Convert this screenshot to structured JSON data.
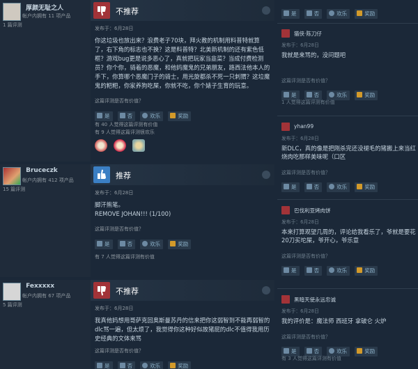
{
  "reviews": [
    {
      "username": "厚颜无耻之人",
      "games_owned": "帐户内拥有 11 项产品",
      "review_count": "1 篇评测",
      "verdict": "不推荐",
      "posted": "发布于：6月28日",
      "text": "你这垃圾也放出来？浪费老子70块，拜火教的机制用料普特就算了，右下角的标志也不换？这是料普特？北美新机制的还有紫色低框？游戏bug更是说多恶心了，真就把玩家当韭菜？当成付费检测员？你个你，骑着的恶魔，和他妈魔鬼的兄弟朋友，路西法他本人的手下，你算哪个恶魔门子的骑士，用光旋都杀不死一只刺猬？这垃魔鬼的粑粑，你家养狗吃屎，你就不吃，你个婊子生育的玩意。",
      "helpful_q": "这篇评测是否有价值？",
      "btn_yes": "是",
      "btn_no": "否",
      "btn_funny": "欢乐",
      "btn_award": "奖励",
      "stat1": "有 40 人觉得这篇评测有价值",
      "stat2": "有 9 人觉得这篇评测很欢乐"
    },
    {
      "username": "Bruceczk",
      "games_owned": "帐户内拥有 412 项产品",
      "review_count": "15 篇评测",
      "verdict": "推荐",
      "posted": "发布于：6月28日",
      "text1": "脚汗熊笔。",
      "text2": "REMOVE JOHAN!!! (1/100)",
      "helpful_q": "这篇评测是否有价值？",
      "btn_yes": "是",
      "btn_no": "否",
      "btn_funny": "欢乐",
      "btn_award": "奖励",
      "stat1": "有 7 人觉得这篇评测有价值"
    },
    {
      "username": "Fexxxxx",
      "games_owned": "帐户内拥有 67 项产品",
      "review_count": "5 篇评测",
      "verdict": "不推荐",
      "posted": "发布于：6月28日",
      "text": "我真他妈想用哥萨克回奥斯曼苏丹的信来把你这弱智到不能再弱智的dlc骂一遍，但太烦了，我觉得你这种好似故猪屁的dlc不值得我用历史经典的文体来骂",
      "helpful_q": "这篇评测是否有价值？",
      "btn_yes": "是",
      "btn_no": "否",
      "btn_funny": "欢乐",
      "btn_award": "奖励"
    }
  ],
  "right_top": {
    "btn_yes": "是",
    "btn_no": "否",
    "btn_funny": "欢乐",
    "btn_award": "奖励"
  },
  "comments": [
    {
      "username": "猫侠·陈刀仔",
      "posted": "发布于：6月28日",
      "text": "我就是来骂的，没问题吧",
      "helpful_q": "这篇评测是否有价值？",
      "btn_yes": "是",
      "btn_no": "否",
      "btn_funny": "欢乐",
      "btn_award": "奖励",
      "stat": "1 人觉得这篇评测有价值"
    },
    {
      "username": "yhan99",
      "posted": "发布于：6月28日",
      "text": "新DLC，真的像是把刚杀完还没褪毛的猪搬上来当红烧肉吃那样美味呢（口区",
      "helpful_q": "这篇评测是否有价值？",
      "btn_yes": "是",
      "btn_no": "否",
      "btn_funny": "欢乐",
      "btn_award": "奖励"
    },
    {
      "username": "巴伐利亚烤肉饼",
      "posted": "发布于：6月28日",
      "text": "本来打算观望几周的，评论给我看乐了，爷就是要花20刀买坨屎，爷开心，爷乐意",
      "helpful_q": "这篇评测是否有价值？",
      "btn_yes": "是",
      "btn_no": "否",
      "btn_funny": "欢乐",
      "btn_award": "奖励"
    },
    {
      "username": "黑暗天使永远忠诚",
      "posted": "发布于：6月28日",
      "text": "我的评价是：魔法师 西班牙 拿破仑 火炉",
      "helpful_q": "这篇评测是否有价值？",
      "btn_yes": "是",
      "btn_no": "否",
      "btn_funny": "欢乐",
      "btn_award": "奖励",
      "stat": "有 3 人觉得这篇评测有价值"
    }
  ]
}
